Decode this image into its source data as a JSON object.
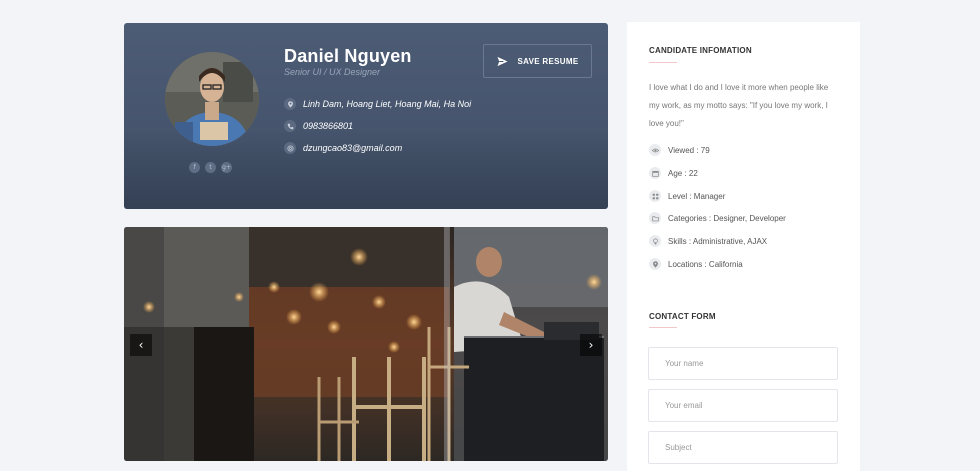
{
  "profile": {
    "name": "Daniel Nguyen",
    "title": "Senior UI / UX Designer",
    "address": "Linh Dam, Hoang Liet, Hoang Mai, Ha Noi",
    "phone": "0983866801",
    "email": "dzungcao83@gmail.com",
    "save_label": "SAVE RESUME",
    "social": [
      "f",
      "t",
      "g+"
    ]
  },
  "slider": {
    "prev_label": "‹",
    "next_label": "›"
  },
  "sidebar": {
    "info_title": "CANDIDATE INFOMATION",
    "bio": "I love what I do and I love it more when people like my work, as my motto says: \"If you love my work, I love you!\"",
    "meta": [
      {
        "icon": "eye-icon",
        "text": "Viewed : 79"
      },
      {
        "icon": "calendar-icon",
        "text": "Age : 22"
      },
      {
        "icon": "level-icon",
        "text": "Level : Manager"
      },
      {
        "icon": "folder-icon",
        "text": "Categories : Designer, Developer"
      },
      {
        "icon": "bulb-icon",
        "text": "Skills : Administrative, AJAX"
      },
      {
        "icon": "map-pin-icon",
        "text": "Locations : California"
      }
    ],
    "contact_title": "CONTACT FORM",
    "fields": {
      "name_placeholder": "Your name",
      "email_placeholder": "Your email",
      "subject_placeholder": "Subject"
    }
  },
  "colors": {
    "card_bg": "#4a5870",
    "page_bg": "#f3f4f7",
    "accent_line": "#f1c7c7"
  }
}
